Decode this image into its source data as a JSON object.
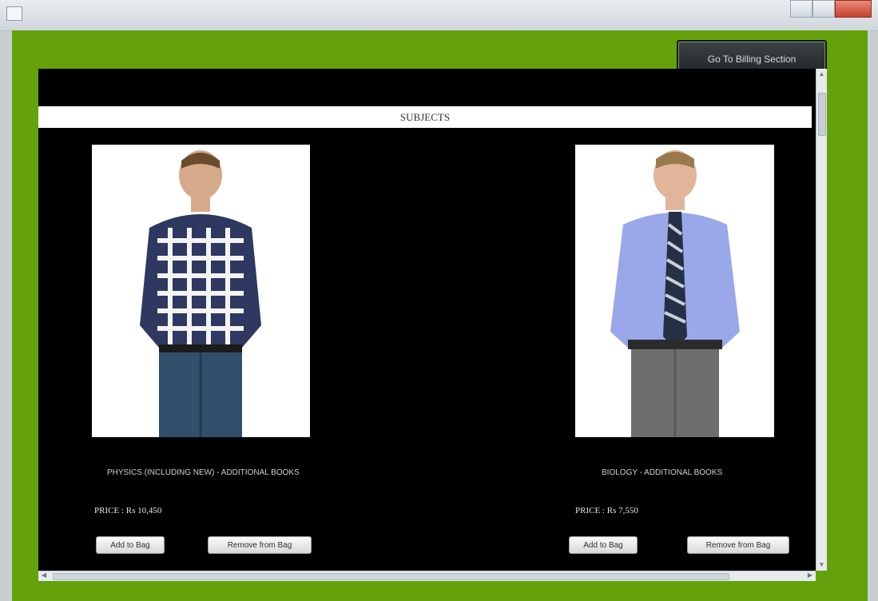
{
  "window": {
    "title": ""
  },
  "toolbar": {
    "go_button_label": "Go To Billing Section"
  },
  "section": {
    "title": "SUBJECTS"
  },
  "products": [
    {
      "name": "PHYSICS (INCLUDING NEW) - ADDITIONAL BOOKS",
      "price": "PRICE : Rs 10,450",
      "add_label": "Add to Bag",
      "remove_label": "Remove from Bag"
    },
    {
      "name": "BIOLOGY - ADDITIONAL BOOKS",
      "price": "PRICE : Rs 7,550",
      "add_label": "Add to Bag",
      "remove_label": "Remove from Bag"
    }
  ],
  "colors": {
    "window_bg": "#65a10a",
    "panel_bg": "#000000"
  }
}
